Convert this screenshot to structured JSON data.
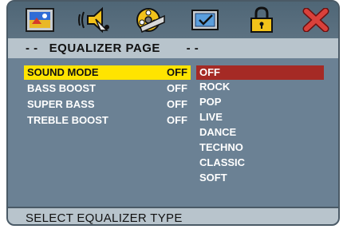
{
  "icon_bar": {
    "icons": [
      "picture-icon",
      "speaker-audio-icon",
      "film-reel-icon",
      "checkbox-icon",
      "lock-icon",
      "close-icon"
    ]
  },
  "header": {
    "title": "- -   EQUALIZER PAGE       - -"
  },
  "settings": [
    {
      "label": "SOUND MODE",
      "value": "OFF"
    },
    {
      "label": "BASS BOOST",
      "value": "OFF"
    },
    {
      "label": "SUPER BASS",
      "value": "OFF"
    },
    {
      "label": "TREBLE BOOST",
      "value": "OFF"
    }
  ],
  "options": [
    "OFF",
    "ROCK",
    "POP",
    "LIVE",
    "DANCE",
    "TECHNO",
    "CLASSIC",
    "SOFT"
  ],
  "status": {
    "text": "SELECT EQUALIZER TYPE"
  },
  "colors": {
    "selected_setting": "#ffe400",
    "selected_option": "#a52a25",
    "panel": "#6b8194",
    "bar": "#b8c4cc"
  }
}
